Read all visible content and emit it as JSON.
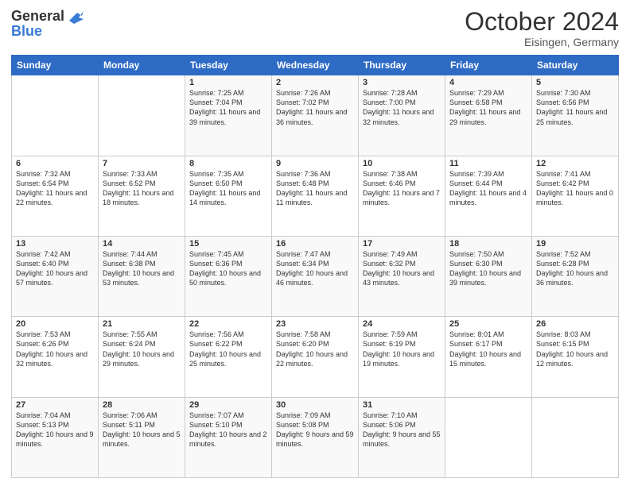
{
  "header": {
    "logo_line1": "General",
    "logo_line2": "Blue",
    "month": "October 2024",
    "location": "Eisingen, Germany"
  },
  "weekdays": [
    "Sunday",
    "Monday",
    "Tuesday",
    "Wednesday",
    "Thursday",
    "Friday",
    "Saturday"
  ],
  "weeks": [
    [
      {
        "day": "",
        "sunrise": "",
        "sunset": "",
        "daylight": ""
      },
      {
        "day": "",
        "sunrise": "",
        "sunset": "",
        "daylight": ""
      },
      {
        "day": "1",
        "sunrise": "Sunrise: 7:25 AM",
        "sunset": "Sunset: 7:04 PM",
        "daylight": "Daylight: 11 hours and 39 minutes."
      },
      {
        "day": "2",
        "sunrise": "Sunrise: 7:26 AM",
        "sunset": "Sunset: 7:02 PM",
        "daylight": "Daylight: 11 hours and 36 minutes."
      },
      {
        "day": "3",
        "sunrise": "Sunrise: 7:28 AM",
        "sunset": "Sunset: 7:00 PM",
        "daylight": "Daylight: 11 hours and 32 minutes."
      },
      {
        "day": "4",
        "sunrise": "Sunrise: 7:29 AM",
        "sunset": "Sunset: 6:58 PM",
        "daylight": "Daylight: 11 hours and 29 minutes."
      },
      {
        "day": "5",
        "sunrise": "Sunrise: 7:30 AM",
        "sunset": "Sunset: 6:56 PM",
        "daylight": "Daylight: 11 hours and 25 minutes."
      }
    ],
    [
      {
        "day": "6",
        "sunrise": "Sunrise: 7:32 AM",
        "sunset": "Sunset: 6:54 PM",
        "daylight": "Daylight: 11 hours and 22 minutes."
      },
      {
        "day": "7",
        "sunrise": "Sunrise: 7:33 AM",
        "sunset": "Sunset: 6:52 PM",
        "daylight": "Daylight: 11 hours and 18 minutes."
      },
      {
        "day": "8",
        "sunrise": "Sunrise: 7:35 AM",
        "sunset": "Sunset: 6:50 PM",
        "daylight": "Daylight: 11 hours and 14 minutes."
      },
      {
        "day": "9",
        "sunrise": "Sunrise: 7:36 AM",
        "sunset": "Sunset: 6:48 PM",
        "daylight": "Daylight: 11 hours and 11 minutes."
      },
      {
        "day": "10",
        "sunrise": "Sunrise: 7:38 AM",
        "sunset": "Sunset: 6:46 PM",
        "daylight": "Daylight: 11 hours and 7 minutes."
      },
      {
        "day": "11",
        "sunrise": "Sunrise: 7:39 AM",
        "sunset": "Sunset: 6:44 PM",
        "daylight": "Daylight: 11 hours and 4 minutes."
      },
      {
        "day": "12",
        "sunrise": "Sunrise: 7:41 AM",
        "sunset": "Sunset: 6:42 PM",
        "daylight": "Daylight: 11 hours and 0 minutes."
      }
    ],
    [
      {
        "day": "13",
        "sunrise": "Sunrise: 7:42 AM",
        "sunset": "Sunset: 6:40 PM",
        "daylight": "Daylight: 10 hours and 57 minutes."
      },
      {
        "day": "14",
        "sunrise": "Sunrise: 7:44 AM",
        "sunset": "Sunset: 6:38 PM",
        "daylight": "Daylight: 10 hours and 53 minutes."
      },
      {
        "day": "15",
        "sunrise": "Sunrise: 7:45 AM",
        "sunset": "Sunset: 6:36 PM",
        "daylight": "Daylight: 10 hours and 50 minutes."
      },
      {
        "day": "16",
        "sunrise": "Sunrise: 7:47 AM",
        "sunset": "Sunset: 6:34 PM",
        "daylight": "Daylight: 10 hours and 46 minutes."
      },
      {
        "day": "17",
        "sunrise": "Sunrise: 7:49 AM",
        "sunset": "Sunset: 6:32 PM",
        "daylight": "Daylight: 10 hours and 43 minutes."
      },
      {
        "day": "18",
        "sunrise": "Sunrise: 7:50 AM",
        "sunset": "Sunset: 6:30 PM",
        "daylight": "Daylight: 10 hours and 39 minutes."
      },
      {
        "day": "19",
        "sunrise": "Sunrise: 7:52 AM",
        "sunset": "Sunset: 6:28 PM",
        "daylight": "Daylight: 10 hours and 36 minutes."
      }
    ],
    [
      {
        "day": "20",
        "sunrise": "Sunrise: 7:53 AM",
        "sunset": "Sunset: 6:26 PM",
        "daylight": "Daylight: 10 hours and 32 minutes."
      },
      {
        "day": "21",
        "sunrise": "Sunrise: 7:55 AM",
        "sunset": "Sunset: 6:24 PM",
        "daylight": "Daylight: 10 hours and 29 minutes."
      },
      {
        "day": "22",
        "sunrise": "Sunrise: 7:56 AM",
        "sunset": "Sunset: 6:22 PM",
        "daylight": "Daylight: 10 hours and 25 minutes."
      },
      {
        "day": "23",
        "sunrise": "Sunrise: 7:58 AM",
        "sunset": "Sunset: 6:20 PM",
        "daylight": "Daylight: 10 hours and 22 minutes."
      },
      {
        "day": "24",
        "sunrise": "Sunrise: 7:59 AM",
        "sunset": "Sunset: 6:19 PM",
        "daylight": "Daylight: 10 hours and 19 minutes."
      },
      {
        "day": "25",
        "sunrise": "Sunrise: 8:01 AM",
        "sunset": "Sunset: 6:17 PM",
        "daylight": "Daylight: 10 hours and 15 minutes."
      },
      {
        "day": "26",
        "sunrise": "Sunrise: 8:03 AM",
        "sunset": "Sunset: 6:15 PM",
        "daylight": "Daylight: 10 hours and 12 minutes."
      }
    ],
    [
      {
        "day": "27",
        "sunrise": "Sunrise: 7:04 AM",
        "sunset": "Sunset: 5:13 PM",
        "daylight": "Daylight: 10 hours and 9 minutes."
      },
      {
        "day": "28",
        "sunrise": "Sunrise: 7:06 AM",
        "sunset": "Sunset: 5:11 PM",
        "daylight": "Daylight: 10 hours and 5 minutes."
      },
      {
        "day": "29",
        "sunrise": "Sunrise: 7:07 AM",
        "sunset": "Sunset: 5:10 PM",
        "daylight": "Daylight: 10 hours and 2 minutes."
      },
      {
        "day": "30",
        "sunrise": "Sunrise: 7:09 AM",
        "sunset": "Sunset: 5:08 PM",
        "daylight": "Daylight: 9 hours and 59 minutes."
      },
      {
        "day": "31",
        "sunrise": "Sunrise: 7:10 AM",
        "sunset": "Sunset: 5:06 PM",
        "daylight": "Daylight: 9 hours and 55 minutes."
      },
      {
        "day": "",
        "sunrise": "",
        "sunset": "",
        "daylight": ""
      },
      {
        "day": "",
        "sunrise": "",
        "sunset": "",
        "daylight": ""
      }
    ]
  ]
}
